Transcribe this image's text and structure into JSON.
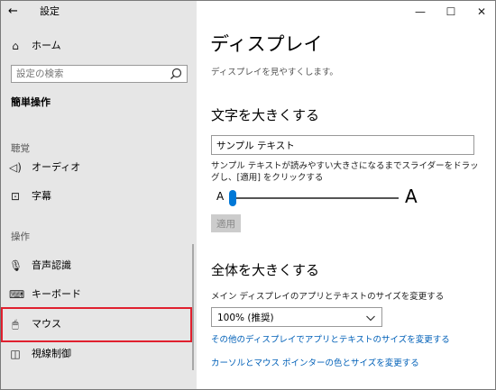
{
  "window": {
    "title": "設定",
    "controls": {
      "minimize": "—",
      "maximize": "☐",
      "close": "✕"
    }
  },
  "sidebar": {
    "back_glyph": "←",
    "home": {
      "icon": "⌂",
      "label": "ホーム"
    },
    "search": {
      "placeholder": "設定の検索"
    },
    "section_title": "簡単操作",
    "groups": [
      {
        "label": "聴覚",
        "items": [
          {
            "icon": "◁)",
            "label": "オーディオ"
          },
          {
            "icon": "⊡",
            "label": "字幕"
          }
        ]
      },
      {
        "label": "操作",
        "items": [
          {
            "icon": "🎙",
            "label": "音声認識"
          },
          {
            "icon": "⌨",
            "label": "キーボード"
          },
          {
            "icon": "🖱",
            "label": "マウス"
          },
          {
            "icon": "◫",
            "label": "視線制御"
          }
        ]
      }
    ]
  },
  "main": {
    "title": "ディスプレイ",
    "subtitle": "ディスプレイを見やすくします。",
    "text_section": {
      "heading": "文字を大きくする",
      "preview_value": "サンプル テキスト",
      "description": "サンプル テキストが読みやすい大きさになるまでスライダーをドラッグし、[適用] をクリックする",
      "slider_min_label": "A",
      "slider_max_label": "A",
      "slider_value_percent": 0,
      "apply_label": "適用"
    },
    "all_section": {
      "heading": "全体を大きくする",
      "description": "メイン ディスプレイのアプリとテキストのサイズを変更する",
      "select_value": "100% (推奨)",
      "links": [
        "その他のディスプレイでアプリとテキストのサイズを変更する",
        "カーソルとマウス ポインターの色とサイズを変更する"
      ]
    }
  },
  "colors": {
    "accent": "#0078d7",
    "link": "#0060b8",
    "highlight_border": "#e0202e",
    "sidebar_bg": "#e6e6e6"
  }
}
